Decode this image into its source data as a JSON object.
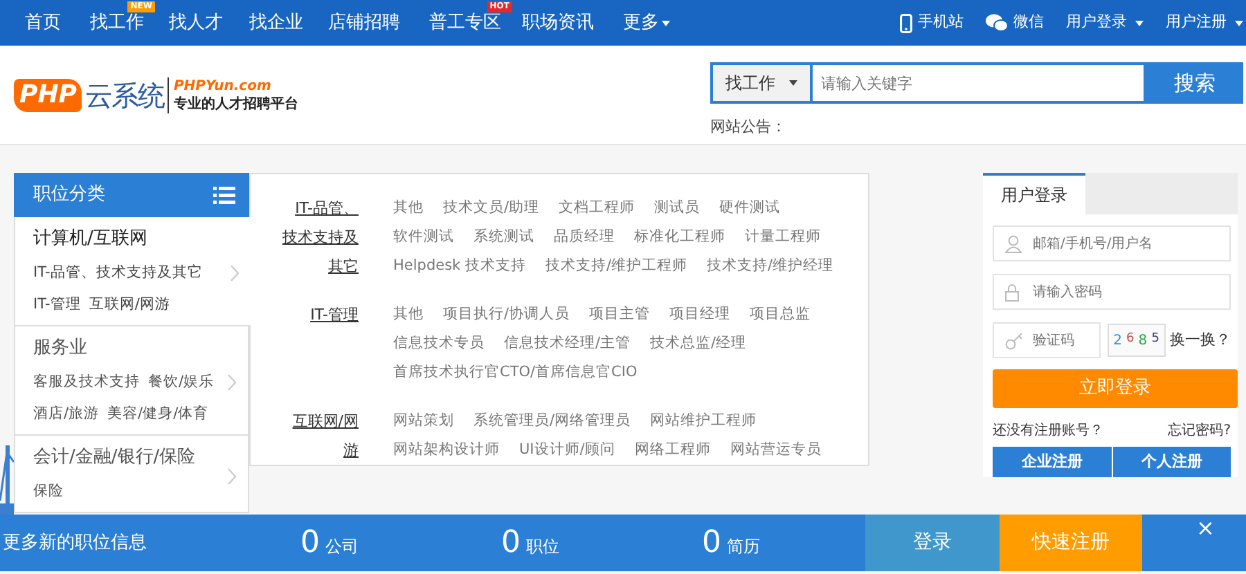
{
  "nav": {
    "items": [
      {
        "label": "首页"
      },
      {
        "label": "找工作",
        "badge": "NEW"
      },
      {
        "label": "找人才"
      },
      {
        "label": "找企业"
      },
      {
        "label": "店铺招聘"
      },
      {
        "label": "普工专区",
        "badge": "HOT"
      },
      {
        "label": "职场资讯"
      },
      {
        "label": "更多",
        "dropdown": true
      }
    ],
    "right": [
      {
        "label": "手机站",
        "kind": "phone"
      },
      {
        "label": "微信",
        "kind": "wechat"
      },
      {
        "label": "用户登录",
        "kind": "dropdown"
      },
      {
        "label": "用户注册",
        "kind": "dropdown"
      }
    ]
  },
  "logo": {
    "mark": "PHP",
    "name": "云系统",
    "domain": "PHPYun.com",
    "slogan": "专业的人才招聘平台"
  },
  "search": {
    "type": "找工作",
    "placeholder": "请输入关键字",
    "button": "搜索",
    "notice_label": "网站公告："
  },
  "categories": {
    "title": "职位分类",
    "groups": [
      {
        "title": "计算机/互联网",
        "selected": true,
        "link_rows": [
          [
            "IT-品管、技术支持及其它"
          ],
          [
            "IT-管理",
            "互联网/网游"
          ]
        ]
      },
      {
        "title": "服务业",
        "selected": false,
        "link_rows": [
          [
            "客服及技术支持",
            "餐饮/娱乐"
          ],
          [
            "酒店/旅游",
            "美容/健身/体育"
          ]
        ]
      },
      {
        "title": "会计/金融/银行/保险",
        "selected": false,
        "link_rows": [
          [
            "保险"
          ]
        ]
      }
    ]
  },
  "subcategories": [
    {
      "label": "IT-品管、技术支持及其它",
      "items": [
        "其他",
        "技术文员/助理",
        "文档工程师",
        "测试员",
        "硬件测试",
        "软件测试",
        "系统测试",
        "品质经理",
        "标准化工程师",
        "计量工程师",
        "Helpdesk 技术支持",
        "技术支持/维护工程师",
        "技术支持/维护经理"
      ]
    },
    {
      "label": "IT-管理",
      "items": [
        "其他",
        "项目执行/协调人员",
        "项目主管",
        "项目经理",
        "项目总监",
        "信息技术专员",
        "信息技术经理/主管",
        "技术总监/经理",
        "首席技术执行官CTO/首席信息官CIO"
      ]
    },
    {
      "label": "互联网/网游",
      "items": [
        "网站策划",
        "系统管理员/网络管理员",
        "网站维护工程师",
        "网站架构设计师",
        "UI设计师/顾问",
        "网络工程师",
        "网站营运专员"
      ]
    }
  ],
  "login": {
    "tabs": [
      {
        "label": "用户登录",
        "selected": true
      }
    ],
    "username_placeholder": "邮箱/手机号/用户名",
    "password_placeholder": "请输入密码",
    "captcha_placeholder": "验证码",
    "captcha_digits": [
      {
        "text": "2",
        "color": "#3a8fd0"
      },
      {
        "text": "6",
        "color": "#c0504d"
      },
      {
        "text": "8",
        "color": "#2aa84a"
      },
      {
        "text": "5",
        "color": "#3b3b8f"
      }
    ],
    "refresh": "换一换？",
    "submit": "立即登录",
    "no_account": "还没有注册账号？",
    "forgot": "忘记密码?",
    "register_buttons": [
      "企业注册",
      "个人注册"
    ]
  },
  "bottom_bar": {
    "text": "更多新的职位信息",
    "stats": [
      {
        "value": "0",
        "label": "公司"
      },
      {
        "value": "0",
        "label": "职位"
      },
      {
        "value": "0",
        "label": "简历"
      }
    ],
    "login": "登录",
    "register": "快速注册",
    "close": "×"
  }
}
